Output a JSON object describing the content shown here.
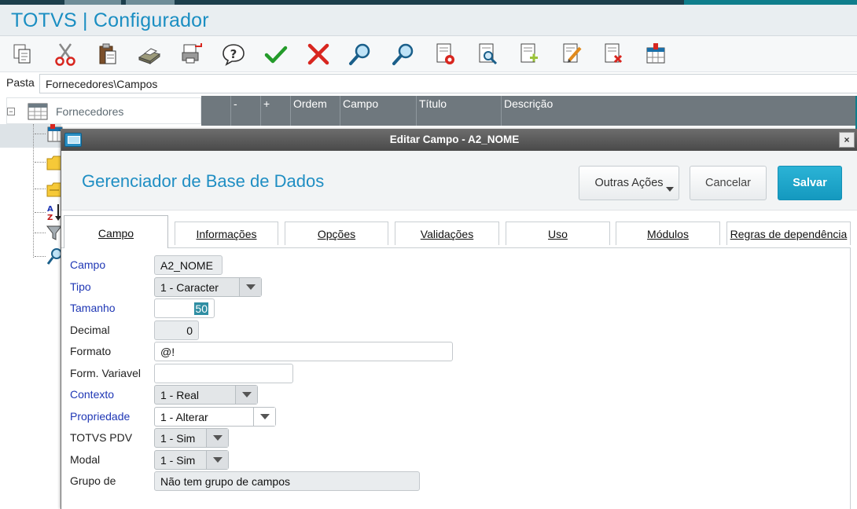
{
  "app": {
    "title": "TOTVS | Configurador"
  },
  "toolbar": {
    "icons": [
      "copy-icon",
      "cut-icon",
      "paste-icon",
      "print-icon",
      "export-icon",
      "help-icon",
      "confirm-check-icon",
      "cancel-x-icon",
      "search-icon",
      "find-next-icon",
      "document-settings-icon",
      "document-preview-icon",
      "add-document-icon",
      "edit-document-icon",
      "delete-document-icon",
      "table-field-icon"
    ]
  },
  "path": {
    "label": "Pasta",
    "value": "Fornecedores\\Campos"
  },
  "tree": {
    "root_label": "Fornecedores"
  },
  "grid": {
    "columns": [
      "-",
      "+",
      "Ordem",
      "Campo",
      "Título",
      "Descrição"
    ]
  },
  "dialog": {
    "title": "Editar Campo - A2_NOME",
    "close_label": "×",
    "heading": "Gerenciador de Base de Dados",
    "buttons": {
      "other_actions": "Outras Ações",
      "cancel": "Cancelar",
      "save": "Salvar"
    },
    "tabs": [
      "Campo",
      "Informações",
      "Opções",
      "Validações",
      "Uso",
      "Módulos",
      "Regras de dependência"
    ],
    "form": {
      "campo": {
        "label": "Campo",
        "value": "A2_NOME"
      },
      "tipo": {
        "label": "Tipo",
        "value": "1 - Caracter"
      },
      "tamanho": {
        "label": "Tamanho",
        "value": "50"
      },
      "decimal": {
        "label": "Decimal",
        "value": "0"
      },
      "formato": {
        "label": "Formato",
        "value": "@!"
      },
      "form_variavel": {
        "label": "Form. Variavel",
        "value": ""
      },
      "contexto": {
        "label": "Contexto",
        "value": "1 - Real"
      },
      "propriedade": {
        "label": "Propriedade",
        "value": "1 - Alterar"
      },
      "totvs_pdv": {
        "label": "TOTVS PDV",
        "value": "1 - Sim"
      },
      "modal": {
        "label": "Modal",
        "value": "1 - Sim"
      },
      "grupo": {
        "label": "Grupo de",
        "value": "Não tem grupo de campos"
      }
    }
  },
  "colors": {
    "accent": "#1a8ec2",
    "save_button": "#1ea6cb",
    "required_label": "#1f37b5",
    "grid_header": "#6f787e"
  }
}
